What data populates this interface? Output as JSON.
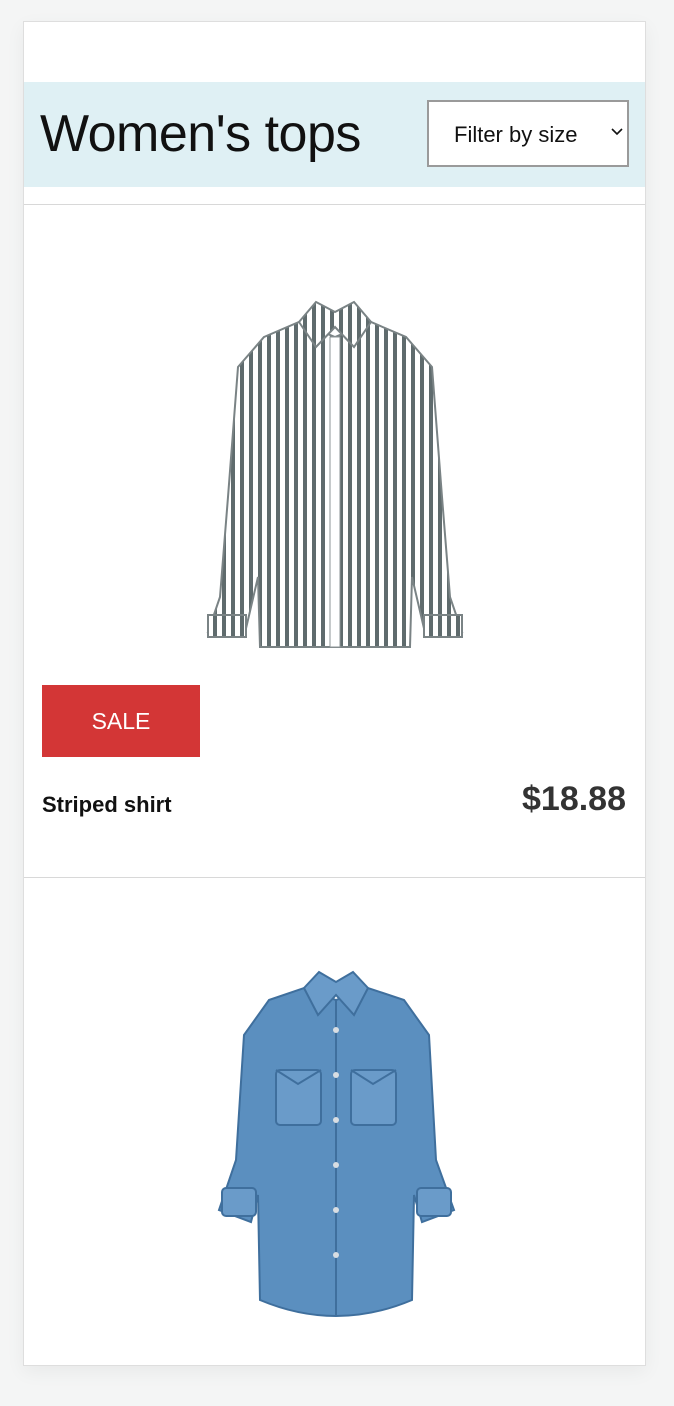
{
  "page": {
    "title": "Women's tops"
  },
  "filter": {
    "label": "Filter by size",
    "icon": "chevron-down-icon"
  },
  "products": [
    {
      "name": "Striped shirt",
      "price": "$18.88",
      "badge": "SALE",
      "image": "striped-shirt-image"
    },
    {
      "name": "",
      "price": "",
      "image": "denim-shirt-image"
    }
  ],
  "colors": {
    "header_bg": "#dff0f4",
    "sale_badge": "#d33636",
    "stripe": "#5f6b6d",
    "denim": "#5b8fbf"
  }
}
